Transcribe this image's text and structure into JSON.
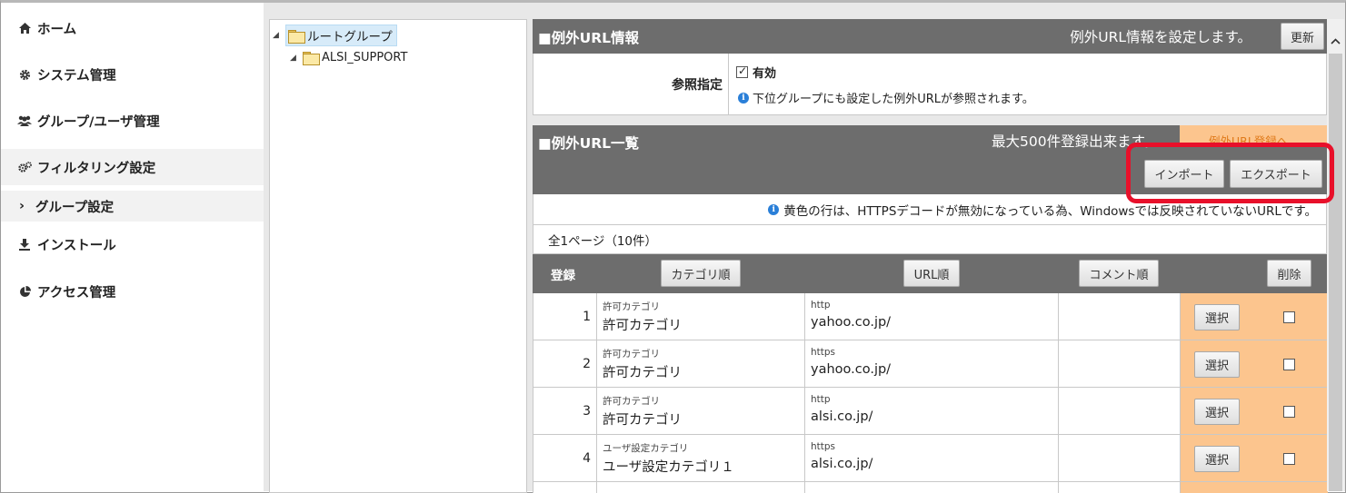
{
  "sidebar": {
    "items": [
      {
        "label": "ホーム",
        "icon": "home-icon"
      },
      {
        "label": "システム管理",
        "icon": "gear-icon"
      },
      {
        "label": "グループ/ユーザ管理",
        "icon": "users-icon"
      },
      {
        "label": "フィルタリング設定",
        "icon": "gears-icon"
      },
      {
        "label": "インストール",
        "icon": "download-icon"
      },
      {
        "label": "アクセス管理",
        "icon": "pie-chart-icon"
      }
    ],
    "sub_item": {
      "label": "グループ設定",
      "chevron": "›"
    }
  },
  "tree": {
    "root": "ルートグループ",
    "child": "ALSI_SUPPORT"
  },
  "exception_info": {
    "title": "■例外URL情報",
    "description": "例外URL情報を設定します。",
    "update_button": "更新",
    "reference_label": "参照指定",
    "enabled_label": "有効",
    "enabled_checked": true,
    "note": "下位グループにも設定した例外URLが参照されます。"
  },
  "exception_list": {
    "title": "■例外URL一覧",
    "max_text": "最大500件登録出来ます。",
    "register_link": "例外URL登録へ",
    "import_button": "インポート",
    "export_button": "エクスポート",
    "notice": "黄色の行は、HTTPSデコードが無効になっている為、Windowsでは反映されていないURLです。",
    "page_info": "全1ページ（10件）",
    "columns": {
      "register": "登録",
      "category_sort": "カテゴリ順",
      "url_sort": "URL順",
      "comment_sort": "コメント順",
      "delete": "削除"
    },
    "rows": [
      {
        "no": "1",
        "cat_small": "許可カテゴリ",
        "cat": "許可カテゴリ",
        "proto": "http",
        "url": "yahoo.co.jp/",
        "select": "選択"
      },
      {
        "no": "2",
        "cat_small": "許可カテゴリ",
        "cat": "許可カテゴリ",
        "proto": "https",
        "url": "yahoo.co.jp/",
        "select": "選択"
      },
      {
        "no": "3",
        "cat_small": "許可カテゴリ",
        "cat": "許可カテゴリ",
        "proto": "http",
        "url": "alsi.co.jp/",
        "select": "選択"
      },
      {
        "no": "4",
        "cat_small": "ユーザ設定カテゴリ",
        "cat": "ユーザ設定カテゴリ１",
        "proto": "https",
        "url": "alsi.co.jp/",
        "select": "選択"
      }
    ]
  },
  "colors": {
    "header_gray": "#6d6d6d",
    "orange_col": "#fcc58e",
    "highlight_red": "#e8102a",
    "info_blue": "#2a7fd8"
  }
}
